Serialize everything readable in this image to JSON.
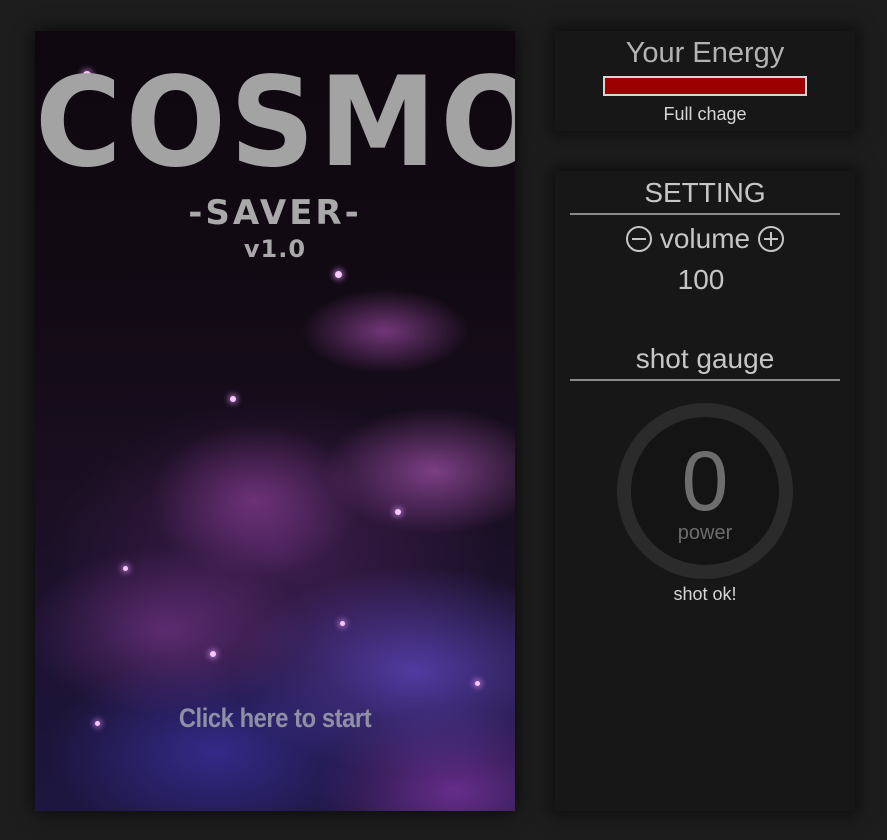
{
  "game": {
    "title": "COSMO",
    "subtitle": "-SAVER-",
    "version": "v1.0",
    "start_label": "Click here to start"
  },
  "energy": {
    "title": "Your Energy",
    "level": 1.0,
    "status": "Full chage",
    "bar_color": "#9c0000"
  },
  "setting": {
    "title": "SETTING",
    "volume": {
      "label": "volume",
      "value": "100",
      "decrease_icon": "minus-circle-icon",
      "increase_icon": "plus-circle-icon"
    },
    "shot_gauge": {
      "title": "shot gauge",
      "value": "0",
      "unit": "power",
      "status": "shot ok!"
    }
  }
}
